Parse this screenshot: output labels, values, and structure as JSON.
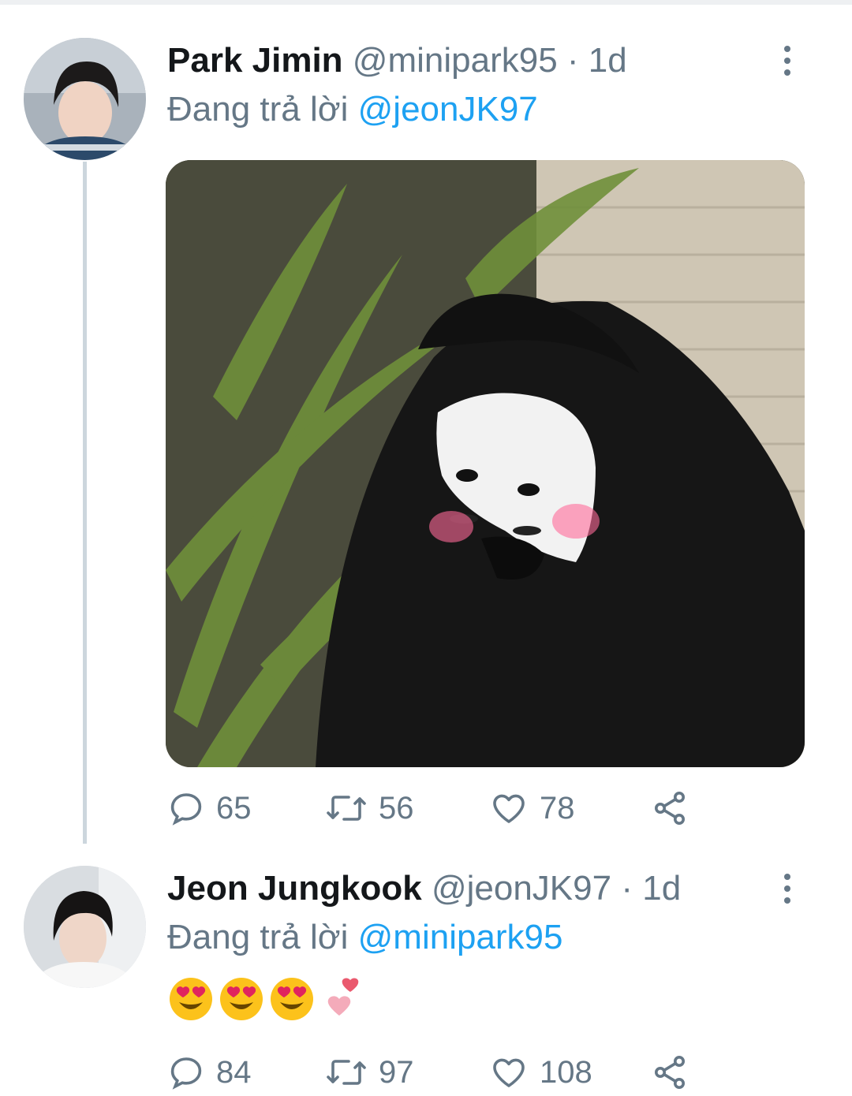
{
  "tweets": [
    {
      "name": "Park Jimin",
      "handle": "@minipark95",
      "separator": "·",
      "time": "1d",
      "reply_prefix": "Đang trả lời",
      "reply_to": "@jeonJK97",
      "stats": {
        "replies": "65",
        "retweets": "56",
        "likes": "78"
      }
    },
    {
      "name": "Jeon Jungkook",
      "handle": "@jeonJK97",
      "separator": "·",
      "time": "1d",
      "reply_prefix": "Đang trả lời",
      "reply_to": "@minipark95",
      "body_emojis": [
        "smiling-face-with-heart-eyes",
        "smiling-face-with-heart-eyes",
        "smiling-face-with-heart-eyes",
        "two-hearts"
      ],
      "stats": {
        "replies": "84",
        "retweets": "97",
        "likes": "108"
      }
    }
  ],
  "colors": {
    "link": "#1da1f2",
    "muted": "#657786",
    "text": "#14171a",
    "thread_line": "#ccd6dd"
  }
}
